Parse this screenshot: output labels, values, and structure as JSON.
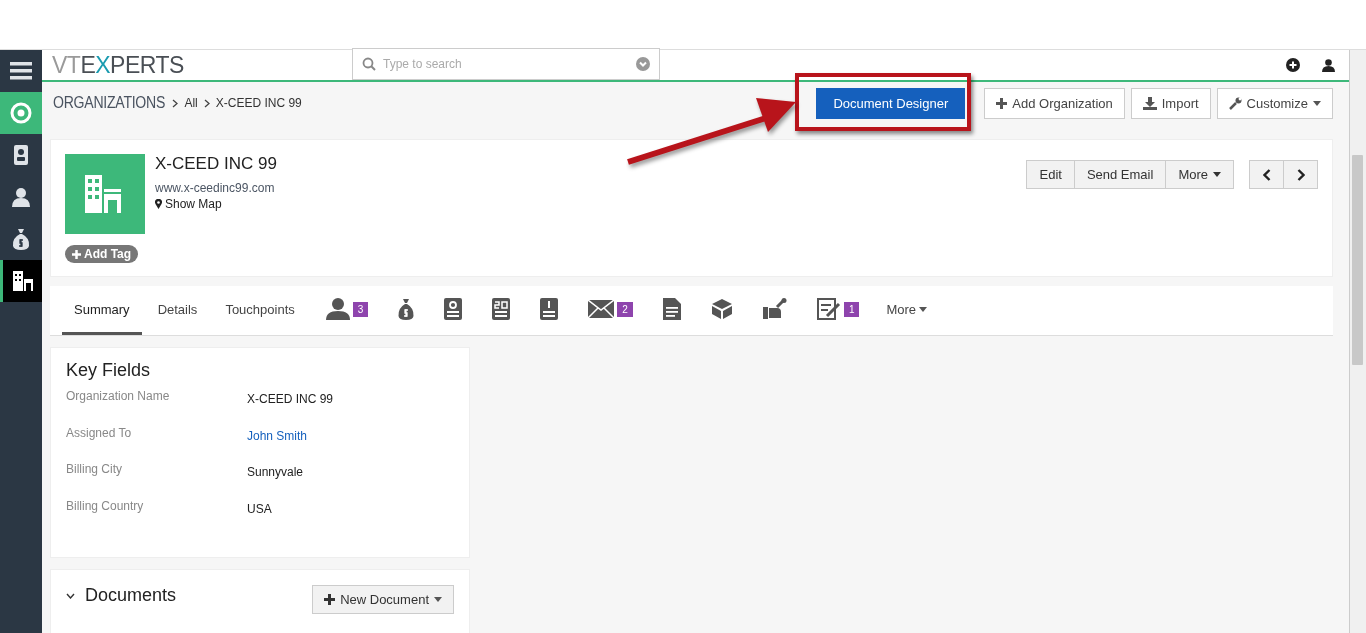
{
  "sidebar": {
    "items": [
      {
        "kind": "menu",
        "selected": false
      },
      {
        "kind": "home",
        "selected": false
      },
      {
        "kind": "contact-book",
        "selected": false
      },
      {
        "kind": "person",
        "selected": false
      },
      {
        "kind": "money",
        "selected": false
      },
      {
        "kind": "building",
        "selected": true
      }
    ]
  },
  "header": {
    "logo": [
      {
        "text": "VT",
        "color": "#9a9a9a"
      },
      {
        "text": "E",
        "color": "#4a4f55"
      },
      {
        "text": "X",
        "color": "#1a9bb0"
      },
      {
        "text": "PERTS",
        "color": "#4a4f55"
      }
    ],
    "search": {
      "placeholder": "Type to search"
    }
  },
  "breadcrumb": [
    "ORGANIZATIONS",
    "All",
    "X-CEED INC 99"
  ],
  "actions": [
    {
      "kind": "primary",
      "label": "Document Designer"
    },
    {
      "kind": "add",
      "label": "Add Organization"
    },
    {
      "kind": "import",
      "label": "Import"
    },
    {
      "kind": "customize",
      "label": "Customize"
    }
  ],
  "record": {
    "name": "X-CEED INC 99",
    "website": "www.x-ceedinc99.com",
    "map_link": "Show Map",
    "tag_button": "Add Tag",
    "buttons": [
      {
        "label": "Edit",
        "dropdown": false
      },
      {
        "label": "Send Email",
        "dropdown": false
      },
      {
        "label": "More",
        "dropdown": true
      }
    ]
  },
  "tabs": [
    {
      "kind": "text",
      "label": "Summary",
      "selected": true
    },
    {
      "kind": "text",
      "label": "Details",
      "selected": false
    },
    {
      "kind": "text",
      "label": "Touchpoints",
      "selected": false
    },
    {
      "kind": "contacts",
      "count": "3",
      "selected": false
    },
    {
      "kind": "deals",
      "selected": false
    },
    {
      "kind": "quotes",
      "selected": false
    },
    {
      "kind": "sales-orders",
      "selected": false
    },
    {
      "kind": "invoices",
      "selected": false
    },
    {
      "kind": "emails",
      "count": "2",
      "selected": false
    },
    {
      "kind": "documents",
      "selected": false
    },
    {
      "kind": "products",
      "selected": false
    },
    {
      "kind": "services",
      "selected": false
    },
    {
      "kind": "tasks",
      "count": "1",
      "selected": false
    },
    {
      "kind": "more",
      "label": "More",
      "selected": false
    }
  ],
  "key_fields": {
    "title": "Key Fields",
    "rows": [
      {
        "label": "Organization Name",
        "value": "X-CEED INC 99",
        "kind": "text"
      },
      {
        "label": "Assigned To",
        "value": "John Smith",
        "kind": "link"
      },
      {
        "label": "Billing City",
        "value": "Sunnyvale",
        "kind": "text"
      },
      {
        "label": "Billing Country",
        "value": "USA",
        "kind": "text"
      }
    ]
  },
  "documents": {
    "title": "Documents",
    "button": "New Document"
  }
}
